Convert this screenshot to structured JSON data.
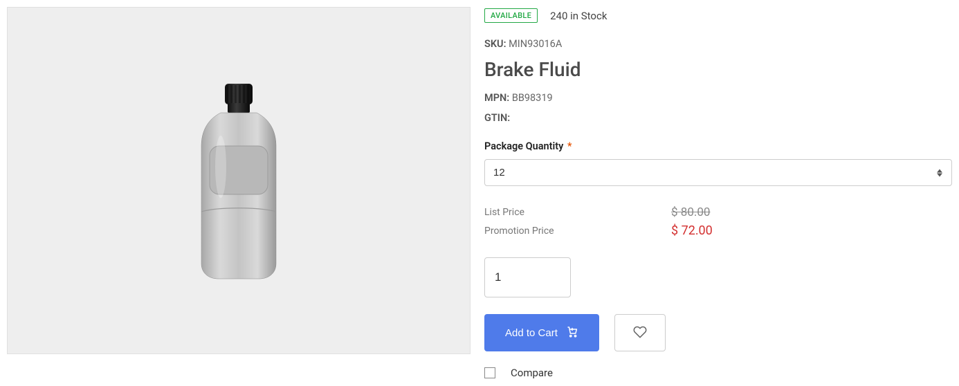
{
  "availability": {
    "badge": "AVAILABLE",
    "stock_text": "240 in Stock"
  },
  "meta": {
    "sku_label": "SKU:",
    "sku_value": "MIN93016A",
    "mpn_label": "MPN:",
    "mpn_value": "BB98319",
    "gtin_label": "GTIN:",
    "gtin_value": ""
  },
  "title": "Brake Fluid",
  "package_qty": {
    "label": "Package Quantity",
    "required_mark": "*",
    "selected": "12"
  },
  "pricing": {
    "list_label": "List Price",
    "list_value": "$ 80.00",
    "promo_label": "Promotion Price",
    "promo_value": "$ 72.00"
  },
  "qty_input_value": "1",
  "actions": {
    "add_to_cart": "Add to Cart",
    "compare_label": "Compare"
  }
}
